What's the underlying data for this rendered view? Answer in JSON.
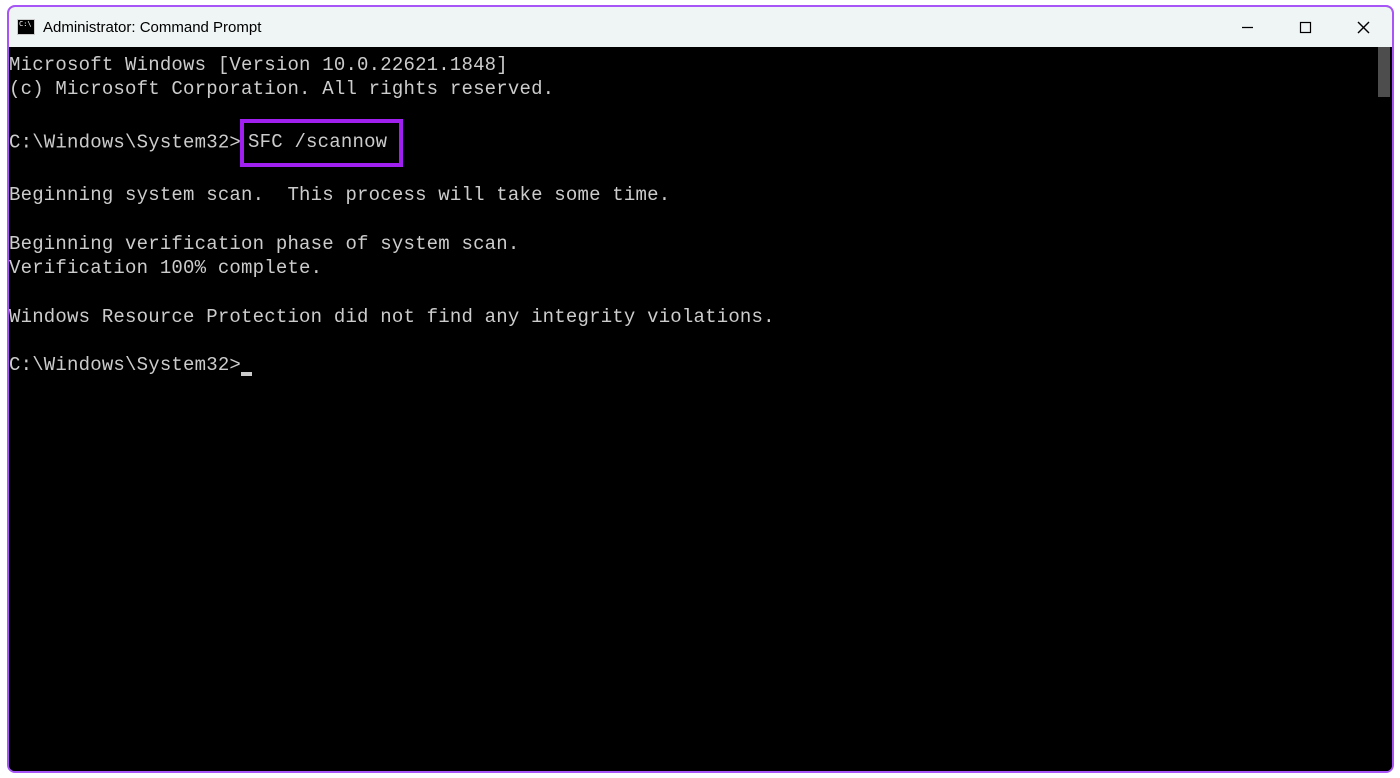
{
  "window": {
    "title": "Administrator: Command Prompt"
  },
  "terminal": {
    "header_line1": "Microsoft Windows [Version 10.0.22621.1848]",
    "header_line2": "(c) Microsoft Corporation. All rights reserved.",
    "prompt1_path": "C:\\Windows\\System32>",
    "prompt1_command": "SFC /scannow",
    "out_line1": "Beginning system scan.  This process will take some time.",
    "out_line2": "Beginning verification phase of system scan.",
    "out_line3": "Verification 100% complete.",
    "out_line4": "Windows Resource Protection did not find any integrity violations.",
    "prompt2_path": "C:\\Windows\\System32>"
  },
  "highlight": {
    "color": "#a020f0"
  }
}
